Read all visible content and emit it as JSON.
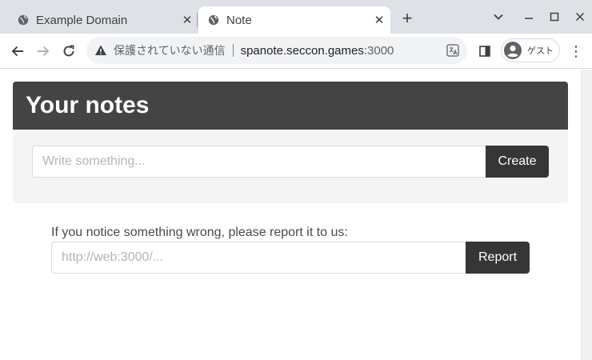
{
  "browser": {
    "tabs": [
      {
        "title": "Example Domain",
        "active": false
      },
      {
        "title": "Note",
        "active": true
      }
    ],
    "new_tab_label": "+",
    "window_controls": {
      "minimize": "—",
      "maximize": "☐",
      "close": "✕"
    },
    "address_bar": {
      "security_text": "保護されていない通信",
      "host": "spanote.seccon.games",
      "port": ":3000"
    },
    "profile_label": "ゲスト",
    "menu_label": "⋮"
  },
  "page": {
    "heading": "Your notes",
    "note_input": {
      "placeholder": "Write something...",
      "value": ""
    },
    "create_button": "Create",
    "report_text": "If you notice something wrong, please report it to us:",
    "report_input": {
      "placeholder": "http://web:3000/...",
      "value": ""
    },
    "report_button": "Report"
  },
  "colors": {
    "header_bg": "#444444",
    "card_bg": "#f4f4f4",
    "button_bg": "#363636",
    "tabstrip_bg": "#dee1e6"
  }
}
